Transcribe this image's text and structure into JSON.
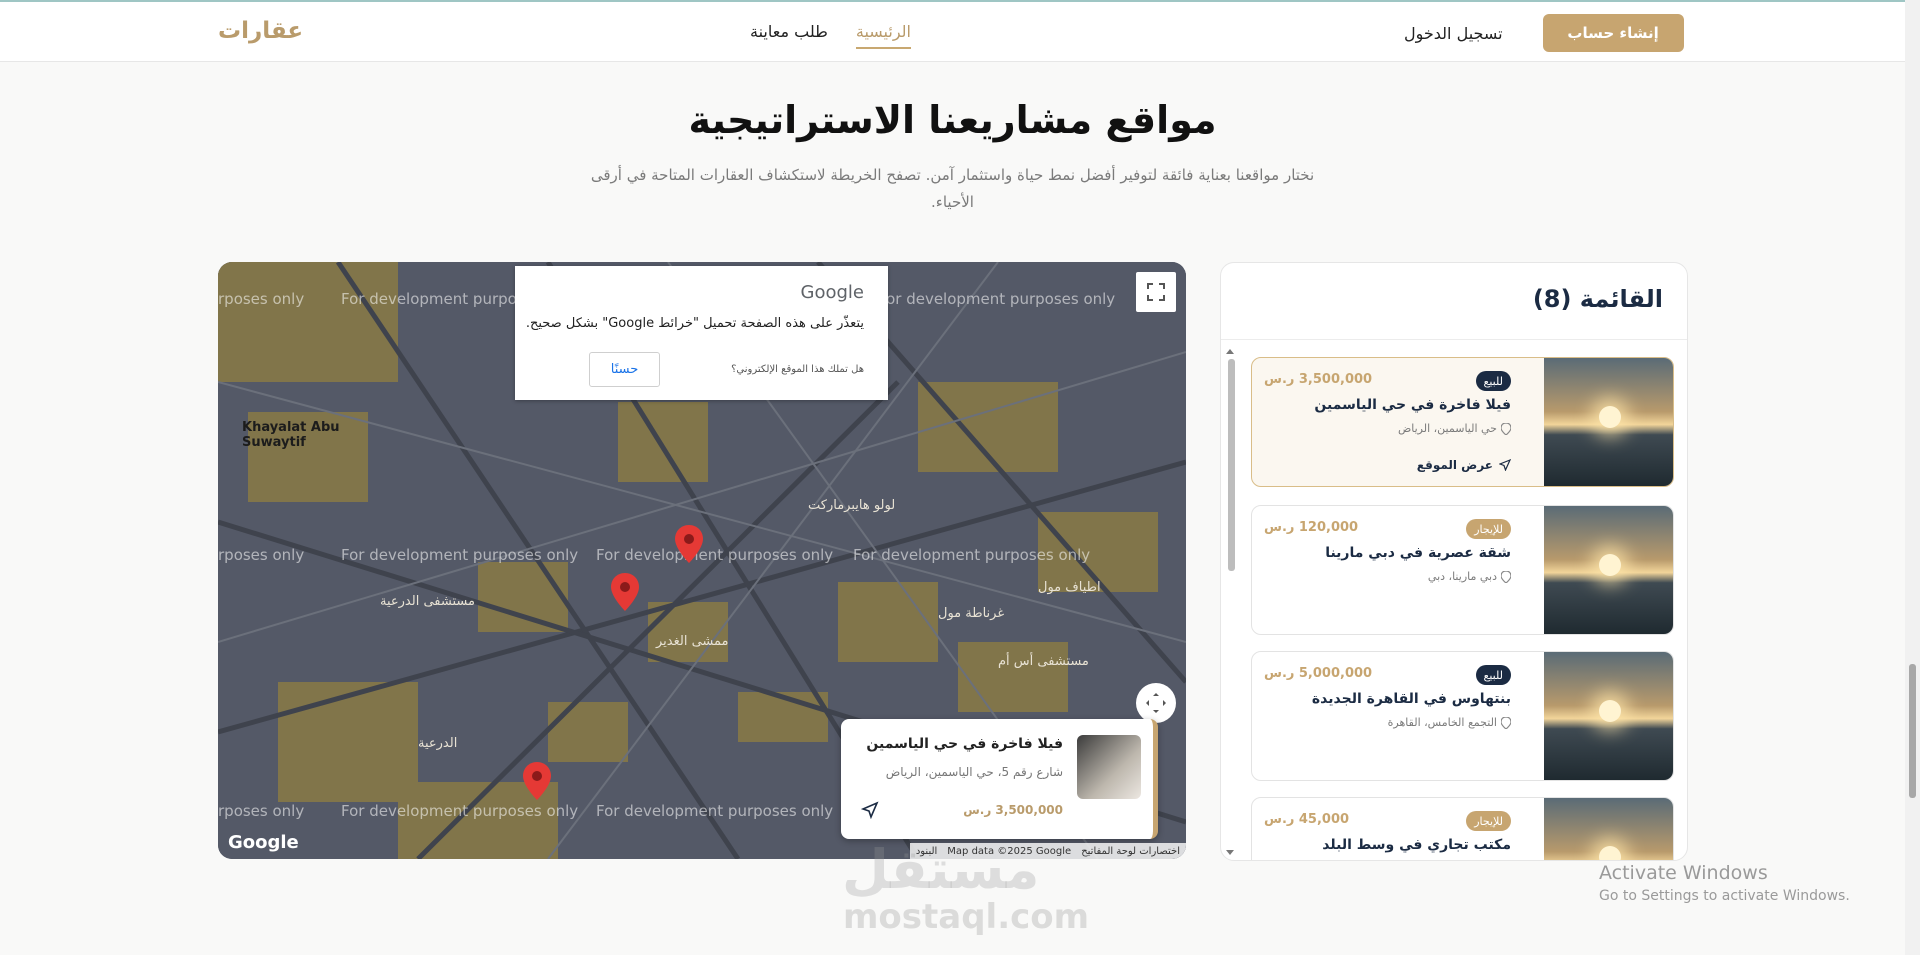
{
  "nav": {
    "brand": "عقارات",
    "links": [
      "الرئيسية",
      "طلب معاينة"
    ],
    "login": "تسجيل الدخول",
    "signup": "إنشاء حساب"
  },
  "section": {
    "title": "مواقع مشاريعنا الاستراتيجية",
    "subtitle": "نختار مواقعنا بعناية فائقة لتوفير أفضل نمط حياة واستثمار آمن. تصفح الخريطة لاستكشاف العقارات المتاحة في أرقى الأحياء."
  },
  "map": {
    "dev_text": "For development purposes only",
    "dev_text_partial": "rposes only",
    "labels_ar": [
      "مستشفى الدرعية",
      "الدرعية",
      "لولو هايبرماركت",
      "ممشى الغدير",
      "غرناطة مول",
      "اطياف مول",
      "مستشفى أس أم"
    ],
    "labels_en": [
      "Khayalat Abu Suwaytif"
    ],
    "google_modal": {
      "logo": "Google",
      "message": "يتعذّر على هذه الصفحة تحميل \"خرائط Google\" بشكل صحيح.",
      "question": "هل تملك هذا الموقع الإلكتروني؟",
      "ok": "حسنًا"
    },
    "google_logo": "Google",
    "attribution": [
      "اختصارات لوحة المفاتيح",
      "Map data ©2025 Google",
      "البنود"
    ],
    "popup": {
      "title": "فيلا فاخرة في حي الياسمين",
      "address": "شارع رقم 5، حي الياسمين، الرياض",
      "price": "3,500,000 ر.س"
    }
  },
  "list": {
    "title": "القائمة (8)",
    "view_label": "عرض الموقع",
    "items": [
      {
        "badge": "للبيع",
        "price": "3,500,000 ر.س",
        "title": "فيلا فاخرة في حي الياسمين",
        "location": "حي الياسمين، الرياض"
      },
      {
        "badge": "للإيجار",
        "price": "120,000 ر.س",
        "title": "شقة عصرية في دبي مارينا",
        "location": "دبي مارينا، دبي"
      },
      {
        "badge": "للبيع",
        "price": "5,000,000 ر.س",
        "title": "بنتهاوس في القاهرة الجديدة",
        "location": "التجمع الخامس، القاهرة"
      },
      {
        "badge": "للإيجار",
        "price": "45,000 ر.س",
        "title": "مكتب تجاري في وسط البلد",
        "location": ""
      }
    ]
  },
  "watermark": {
    "ar": "مستقل",
    "en": "mostaql.com"
  },
  "windows": {
    "line1": "Activate Windows",
    "line2": "Go to Settings to activate Windows."
  },
  "colors": {
    "accent": "#c7a570",
    "navy": "#1b2b43",
    "pin": "#e53935"
  }
}
